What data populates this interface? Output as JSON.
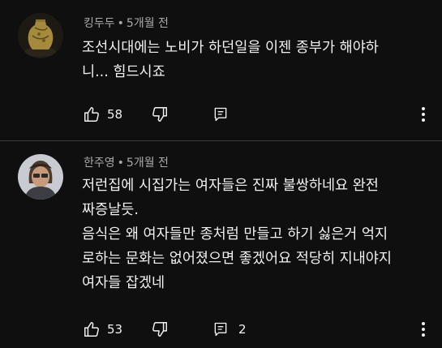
{
  "comments": [
    {
      "author": "킹두두",
      "separator": "•",
      "time": "5개월 전",
      "text": "조선시대에는 노비가 하던일을 이젠 종부가 해야하\n니... 힘드시죠",
      "likes": "58",
      "replies": ""
    },
    {
      "author": "한주영",
      "separator": "•",
      "time": "5개월 전",
      "text": "저런집에 시집가는 여자들은 진짜 불쌍하네요 완전\n짜증날듯.\n음식은 왜 여자들만 종처럼 만들고 하기 싫은거 억지\n로하는 문화는 없어졌으면 좋겠어요 적당히 지내야지\n여자들 잡겠네",
      "likes": "53",
      "replies": "2"
    }
  ],
  "icons": {
    "like": "thumb-up-icon",
    "dislike": "thumb-down-icon",
    "reply": "reply-comment-icon",
    "more": "more-vertical-icon"
  },
  "colors": {
    "background": "#0f0f0f",
    "text_primary": "#f1f1f1",
    "text_secondary": "#aaaaaa"
  }
}
